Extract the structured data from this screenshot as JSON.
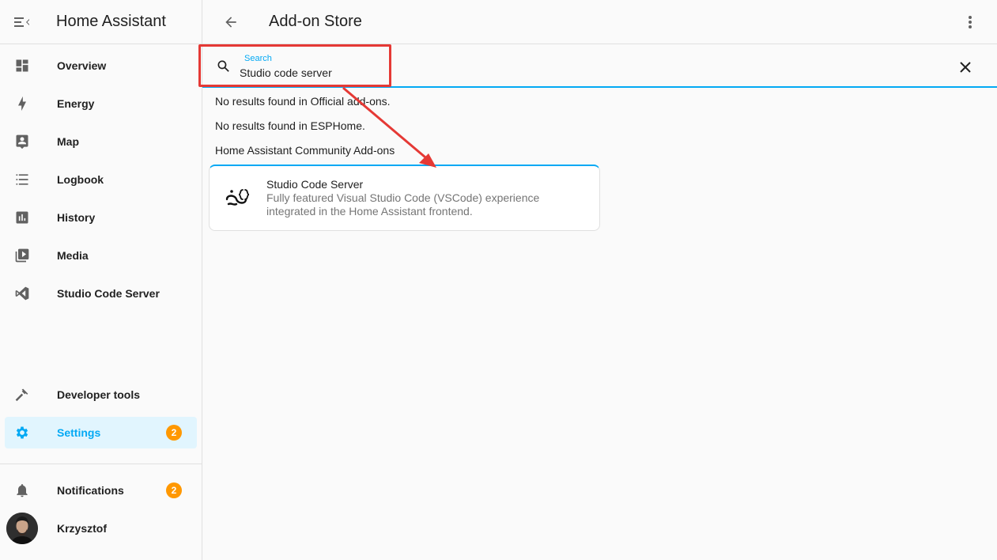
{
  "sidebar": {
    "title": "Home Assistant",
    "items": [
      {
        "label": "Overview",
        "icon": "dashboard-icon"
      },
      {
        "label": "Energy",
        "icon": "lightning-icon"
      },
      {
        "label": "Map",
        "icon": "map-person-icon"
      },
      {
        "label": "Logbook",
        "icon": "list-icon"
      },
      {
        "label": "History",
        "icon": "chart-icon"
      },
      {
        "label": "Media",
        "icon": "media-icon"
      },
      {
        "label": "Studio Code Server",
        "icon": "vscode-icon"
      }
    ],
    "developer_tools": "Developer tools",
    "settings": {
      "label": "Settings",
      "badge": "2"
    },
    "notifications": {
      "label": "Notifications",
      "badge": "2"
    },
    "user": {
      "name": "Krzysztof"
    }
  },
  "header": {
    "title": "Add-on Store"
  },
  "search": {
    "label": "Search",
    "value": "Studio code server"
  },
  "results": {
    "official": "No results found in Official add-ons.",
    "esphome": "No results found in ESPHome.",
    "community_heading": "Home Assistant Community Add-ons"
  },
  "addon": {
    "name": "Studio Code Server",
    "description": "Fully featured Visual Studio Code (VSCode) experience integrated in the Home Assistant frontend."
  },
  "colors": {
    "accent": "#03a9f4",
    "badge": "#ff9800",
    "annotation": "#e53935"
  }
}
